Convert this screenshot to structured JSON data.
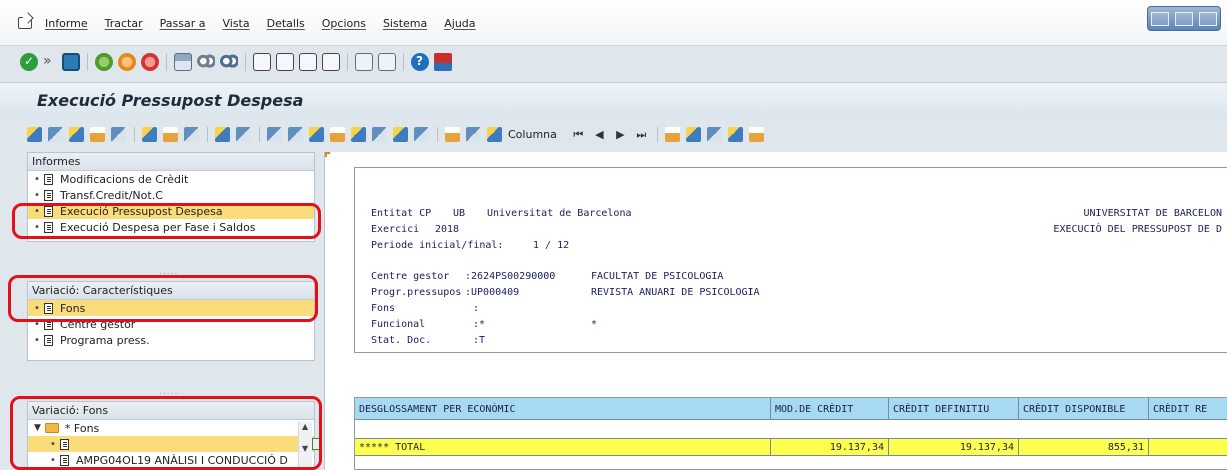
{
  "menu": {
    "items": [
      "Informe",
      "Tractar",
      "Passar a",
      "Vista",
      "Detalls",
      "Opcions",
      "Sistema",
      "Ajuda"
    ]
  },
  "toolbar1": {
    "icons": [
      "check-icon",
      "next-icon",
      "save-icon",
      "back-icon",
      "exit-icon",
      "cancel-icon",
      "print-icon",
      "find-icon",
      "find-next-icon",
      "first-page-icon",
      "previous-page-icon",
      "next-page-icon",
      "last-page-icon",
      "create-session-icon",
      "shortcut-icon",
      "help-icon",
      "customize-layout-icon"
    ]
  },
  "title": "Execució Pressupost Despesa",
  "toolbar2": {
    "column_label": "Columna",
    "nav_glyphs": [
      "⏮",
      "◀",
      "▶",
      "⏭"
    ]
  },
  "sidebar": {
    "informes": {
      "header": "Informes",
      "items": [
        {
          "label": "Modificacions de Crèdit",
          "selected": false
        },
        {
          "label": "Transf.Credit/Not.C",
          "selected": false
        },
        {
          "label": "Execució Pressupost Despesa",
          "selected": true
        },
        {
          "label": "Execució Despesa per Fase i Saldos",
          "selected": false
        }
      ]
    },
    "caracteristiques": {
      "header": "Variació: Característiques",
      "items": [
        {
          "label": "Fons",
          "selected": true
        },
        {
          "label": "Centre gestor",
          "selected": false
        },
        {
          "label": "Programa press.",
          "selected": false
        }
      ]
    },
    "fons": {
      "header": "Variació: Fons",
      "root": "* Fons",
      "items": [
        {
          "label": "",
          "selected": true
        },
        {
          "label": "AMPG04OL19 ANÀLISI I CONDUCCIÓ D",
          "selected": false
        }
      ]
    }
  },
  "report": {
    "entitat_label": "Entitat CP",
    "entitat_code": "UB",
    "entitat_name": "Universitat de Barcelona",
    "exercici_label": "Exercici",
    "exercici_value": "2018",
    "periode_label": "Periode inicial/final:",
    "periode_value": "1 / 12",
    "right_line1": "UNIVERSITAT DE BARCELON",
    "right_line2": "EXECUCIÒ DEL PRESSUPOST DE D",
    "centre_label": "Centre gestor",
    "centre_code": ":2624PS00290000",
    "centre_name": "FACULTAT DE PSICOLOGIA",
    "progr_label": "Progr.pressupos",
    "progr_code": ":UP000409",
    "progr_name": "REVISTA ANUARI DE PSICOLOGIA",
    "fons_label": "Fons",
    "fons_value": ":",
    "funcional_label": "Funcional",
    "funcional_value": ":*",
    "funcional_value2": "*",
    "stat_label": "Stat. Doc.",
    "stat_value": ":T"
  },
  "table": {
    "headers": [
      "DESGLOSSAMENT PER ECONÒMIC",
      "MOD.DE CRÈDIT",
      "CRÈDIT DEFINITIU",
      "CRÈDIT DISPONIBLE",
      "CRÈDIT RE"
    ],
    "total_row": [
      "***** TOTAL",
      "19.137,34",
      "19.137,34",
      "855,31",
      ""
    ]
  }
}
